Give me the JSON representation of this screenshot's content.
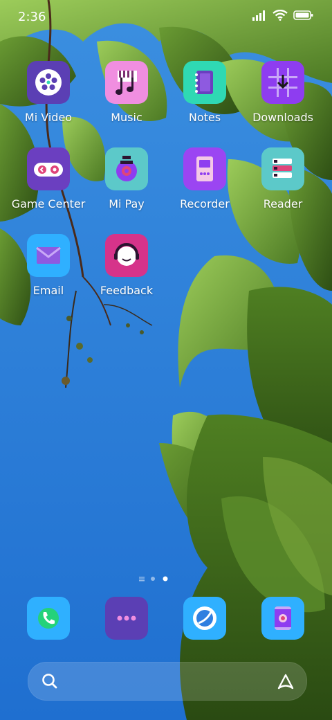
{
  "status_bar": {
    "time": "2:36",
    "icons": [
      "signal-icon",
      "wifi-icon",
      "battery-icon"
    ]
  },
  "apps": [
    {
      "label": "Mi Video",
      "icon": "mi-video-icon",
      "color": "#5b3fb4"
    },
    {
      "label": "Music",
      "icon": "music-icon",
      "color": "#f08ee0"
    },
    {
      "label": "Notes",
      "icon": "notes-icon",
      "color": "#2fd9b3"
    },
    {
      "label": "Downloads",
      "icon": "downloads-icon",
      "color": "#8e3df0"
    },
    {
      "label": "Game Center",
      "icon": "game-center-icon",
      "color": "#6b3fc0"
    },
    {
      "label": "Mi Pay",
      "icon": "mi-pay-icon",
      "color": "#5cc9c9"
    },
    {
      "label": "Recorder",
      "icon": "recorder-icon",
      "color": "#9b45f2"
    },
    {
      "label": "Reader",
      "icon": "reader-icon",
      "color": "#5cc9c9"
    },
    {
      "label": "Email",
      "icon": "email-icon",
      "color": "#2fb0ff"
    },
    {
      "label": "Feedback",
      "icon": "feedback-icon",
      "color": "#d6338a"
    }
  ],
  "page_indicator": {
    "pages": 3,
    "current_page": 3
  },
  "dock": [
    {
      "icon": "phone-icon",
      "color": "#2fb0ff"
    },
    {
      "icon": "messaging-icon",
      "color": "#5b3fb4"
    },
    {
      "icon": "browser-icon",
      "color": "#2fb0ff"
    },
    {
      "icon": "camera-icon",
      "color": "#2fb0ff"
    }
  ],
  "search_bar": {
    "left_icon": "search-icon",
    "right_icon": "assistant-icon"
  }
}
